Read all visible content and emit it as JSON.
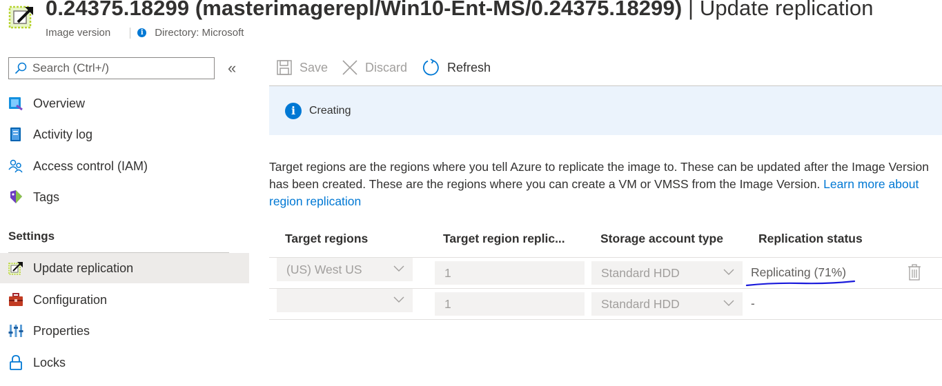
{
  "header": {
    "title": "0.24375.18299 (masterimagerepl/Win10-Ent-MS/0.24375.18299)",
    "separator": " | ",
    "page": "Update replication",
    "resource_type": "Image version",
    "directory": "Directory: Microsoft",
    "icon": "edit-image-icon"
  },
  "search": {
    "placeholder": "Search (Ctrl+/)",
    "value": ""
  },
  "collapse_label": "«",
  "sidebar": {
    "items": [
      {
        "label": "Overview",
        "icon": "overview-icon"
      },
      {
        "label": "Activity log",
        "icon": "activity-log-icon"
      },
      {
        "label": "Access control (IAM)",
        "icon": "iam-icon"
      },
      {
        "label": "Tags",
        "icon": "tag-icon"
      }
    ],
    "section": "Settings",
    "settings_items": [
      {
        "label": "Update replication",
        "icon": "update-replication-icon",
        "active": true
      },
      {
        "label": "Configuration",
        "icon": "configuration-icon"
      },
      {
        "label": "Properties",
        "icon": "properties-icon"
      },
      {
        "label": "Locks",
        "icon": "lock-icon"
      }
    ]
  },
  "toolbar": {
    "save_label": "Save",
    "discard_label": "Discard",
    "refresh_label": "Refresh"
  },
  "banner": {
    "text": "Creating"
  },
  "description": {
    "text": "Target regions are the regions where you tell Azure to replicate the image to. These can be updated after the Image Version has been created. These are the regions where you can create a VM or VMSS from the Image Version. ",
    "link": "Learn more about region replication"
  },
  "table": {
    "headers": [
      "Target regions",
      "Target region replic...",
      "Storage account type",
      "Replication status"
    ],
    "rows": [
      {
        "region": "(US) West US",
        "replicas": "1",
        "storage": "Standard HDD",
        "status": "Replicating (71%)"
      },
      {
        "region": "",
        "replicas": "1",
        "storage": "Standard HDD",
        "status": "-"
      }
    ]
  },
  "colors": {
    "accent": "#0078d4",
    "banner_bg": "#ebf3fc",
    "active_nav": "#edebe9",
    "annotation": "#1a1adb"
  }
}
